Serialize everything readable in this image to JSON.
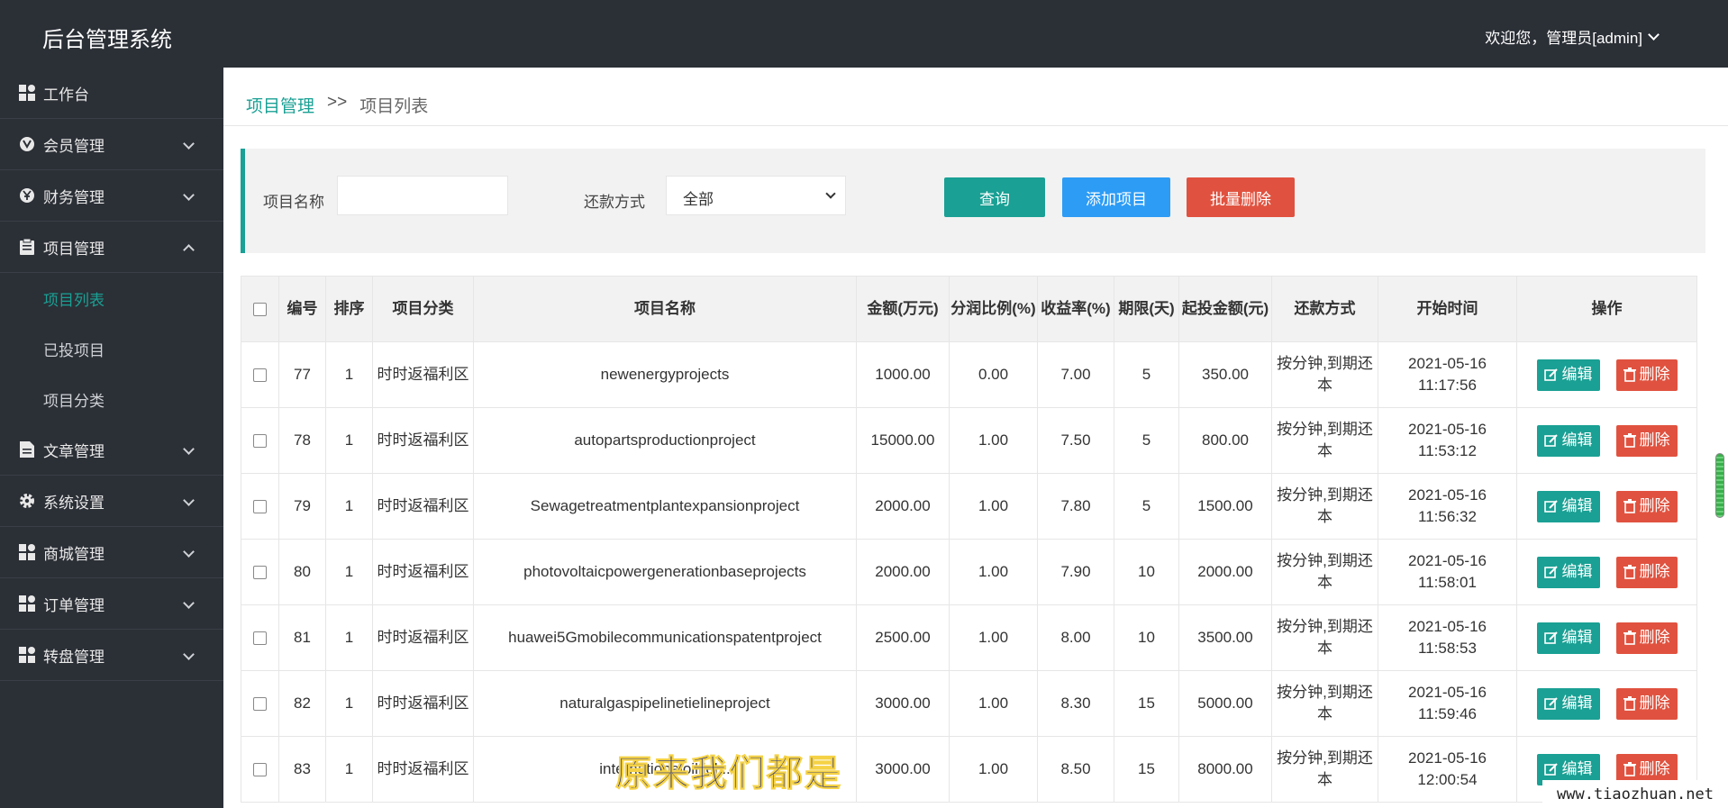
{
  "header": {
    "title": "后台管理系统",
    "user": "欢迎您，管理员[admin]"
  },
  "sidebar": {
    "items": [
      {
        "label": "工作台",
        "icon": "dashboard-icon",
        "expandable": false
      },
      {
        "label": "会员管理",
        "icon": "member-icon",
        "expandable": true
      },
      {
        "label": "财务管理",
        "icon": "finance-icon",
        "expandable": true
      },
      {
        "label": "项目管理",
        "icon": "clipboard-icon",
        "expandable": true,
        "expanded": true,
        "children": [
          {
            "label": "项目列表",
            "active": true
          },
          {
            "label": "已投项目"
          },
          {
            "label": "项目分类"
          }
        ]
      },
      {
        "label": "文章管理",
        "icon": "document-icon",
        "expandable": true
      },
      {
        "label": "系统设置",
        "icon": "gear-icon",
        "expandable": true
      },
      {
        "label": "商城管理",
        "icon": "dashboard-icon",
        "expandable": true
      },
      {
        "label": "订单管理",
        "icon": "dashboard-icon",
        "expandable": true
      },
      {
        "label": "转盘管理",
        "icon": "dashboard-icon",
        "expandable": true
      }
    ]
  },
  "breadcrumb": {
    "parent": "项目管理",
    "sep": ">>",
    "current": "项目列表"
  },
  "search": {
    "name_label": "项目名称",
    "name_value": "",
    "repay_label": "还款方式",
    "repay_value": "全部",
    "query_btn": "查询",
    "add_btn": "添加项目",
    "batch_delete_btn": "批量删除"
  },
  "table": {
    "headers": [
      "编号",
      "排序",
      "项目分类",
      "项目名称",
      "金额(万元)",
      "分润比例(%)",
      "收益率(%)",
      "期限(天)",
      "起投金额(元)",
      "还款方式",
      "开始时间",
      "操作"
    ],
    "edit_label": "编辑",
    "delete_label": "删除",
    "rows": [
      {
        "id": "77",
        "sort": "1",
        "category": "时时返福利区",
        "name": "newenergyprojects",
        "amount": "1000.00",
        "share": "0.00",
        "rate": "7.00",
        "term": "5",
        "min": "350.00",
        "repay": "按分钟,到期还本",
        "start": "2021-05-16 11:17:56"
      },
      {
        "id": "78",
        "sort": "1",
        "category": "时时返福利区",
        "name": "autopartsproductionproject",
        "amount": "15000.00",
        "share": "1.00",
        "rate": "7.50",
        "term": "5",
        "min": "800.00",
        "repay": "按分钟,到期还本",
        "start": "2021-05-16 11:53:12"
      },
      {
        "id": "79",
        "sort": "1",
        "category": "时时返福利区",
        "name": "Sewagetreatmentplantexpansionproject",
        "amount": "2000.00",
        "share": "1.00",
        "rate": "7.80",
        "term": "5",
        "min": "1500.00",
        "repay": "按分钟,到期还本",
        "start": "2021-05-16 11:56:32"
      },
      {
        "id": "80",
        "sort": "1",
        "category": "时时返福利区",
        "name": "photovoltaicpowergenerationbaseprojects",
        "amount": "2000.00",
        "share": "1.00",
        "rate": "7.90",
        "term": "10",
        "min": "2000.00",
        "repay": "按分钟,到期还本",
        "start": "2021-05-16 11:58:01"
      },
      {
        "id": "81",
        "sort": "1",
        "category": "时时返福利区",
        "name": "huawei5Gmobilecommunicationspatentproject",
        "amount": "2500.00",
        "share": "1.00",
        "rate": "8.00",
        "term": "10",
        "min": "3500.00",
        "repay": "按分钟,到期还本",
        "start": "2021-05-16 11:58:53"
      },
      {
        "id": "82",
        "sort": "1",
        "category": "时时返福利区",
        "name": "naturalgaspipelinetielineproject",
        "amount": "3000.00",
        "share": "1.00",
        "rate": "8.30",
        "term": "15",
        "min": "5000.00",
        "repay": "按分钟,到期还本",
        "start": "2021-05-16 11:59:46"
      },
      {
        "id": "83",
        "sort": "1",
        "category": "时时返福利区",
        "name": "internationaloilfiel...",
        "amount": "3000.00",
        "share": "1.00",
        "rate": "8.50",
        "term": "15",
        "min": "8000.00",
        "repay": "按分钟,到期还本",
        "start": "2021-05-16 12:00:54"
      }
    ]
  },
  "overlay": {
    "watermark": "原来我们都是",
    "site": "www.tiaozhuan.net"
  },
  "colors": {
    "accent": "#1aa094",
    "blue": "#2d9cf5",
    "danger": "#e0523f",
    "dark": "#2b2f36"
  }
}
